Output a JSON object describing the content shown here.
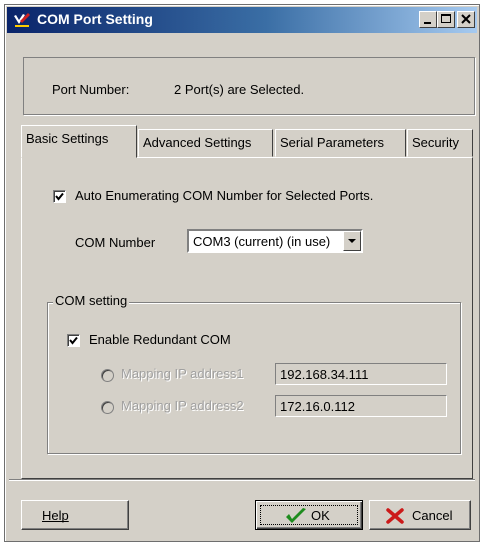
{
  "window": {
    "title": "COM Port Setting",
    "title_bg": "#0a246a",
    "face": "#d4d0c8"
  },
  "titlebar_buttons": [
    {
      "name": "minimize",
      "icon": "minimize-icon"
    },
    {
      "name": "maximize",
      "icon": "maximize-icon"
    },
    {
      "name": "close",
      "icon": "close-icon"
    }
  ],
  "port": {
    "label": "Port Number:",
    "value": "2 Port(s) are Selected."
  },
  "tabs": [
    {
      "label": "Basic Settings",
      "active": true
    },
    {
      "label": "Advanced Settings",
      "active": false
    },
    {
      "label": "Serial Parameters",
      "active": false
    },
    {
      "label": "Security",
      "active": false
    }
  ],
  "basic": {
    "auto_enum_label": "Auto Enumerating COM Number for Selected Ports.",
    "auto_enum_checked": true,
    "com_number_label": "COM Number",
    "com_number_value": "COM3 (current) (in use)"
  },
  "com_setting": {
    "group_label": "COM setting",
    "redundant_label": "Enable Redundant COM",
    "redundant_checked": true,
    "mapping1_label": "Mapping IP address1",
    "mapping1_value": "192.168.34.111",
    "mapping2_label": "Mapping IP address2",
    "mapping2_value": "172.16.0.112"
  },
  "buttons": {
    "help": "Help",
    "ok": "OK",
    "cancel": "Cancel"
  },
  "colors": {
    "ok_check": "#1e8c1e",
    "cancel_x": "#cc1a1a"
  }
}
